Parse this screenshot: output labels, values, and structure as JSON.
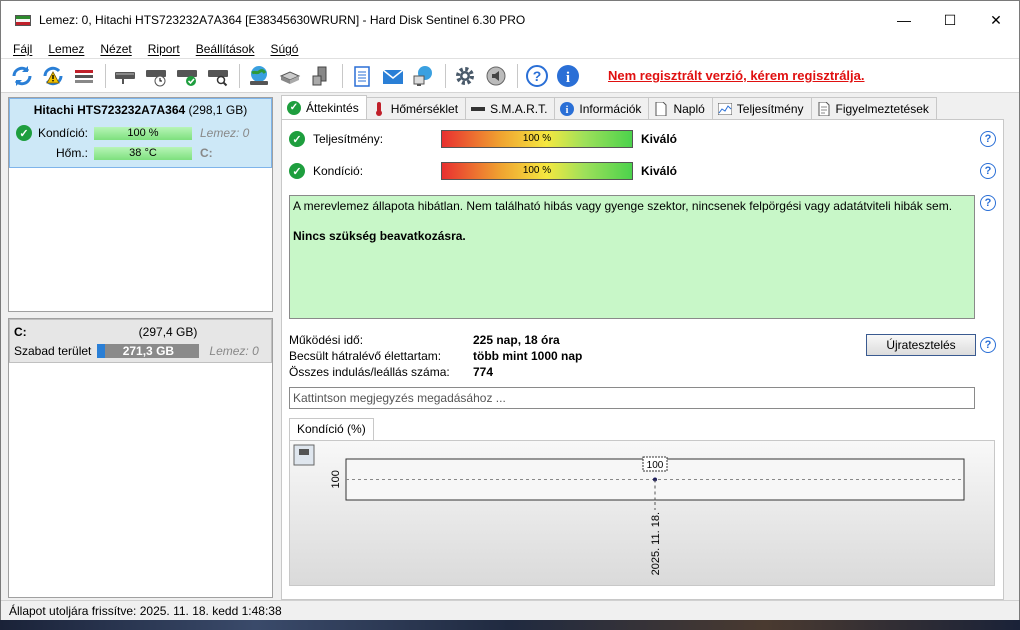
{
  "window": {
    "title": "Lemez: 0, Hitachi HTS723232A7A364 [E38345630WRURN]  -  Hard Disk Sentinel 6.30 PRO",
    "minimize": "—",
    "maximize": "☐",
    "close": "✕"
  },
  "menu": [
    "Fájl",
    "Lemez",
    "Nézet",
    "Riport",
    "Beállítások",
    "Súgó"
  ],
  "toolbar": {
    "icons": [
      "refresh-icon",
      "refresh-warning-icon",
      "disk-bar-icon",
      "disk-icon",
      "disk-clock-icon",
      "disk-check-icon",
      "disk-search-icon",
      "globe-icon",
      "drive-icon",
      "hdd-network-icon",
      "notepad-icon",
      "mail-icon",
      "network-monitor-icon",
      "gear-icon",
      "speaker-icon",
      "help-icon",
      "info-icon"
    ],
    "registration_warning": "Nem regisztrált verzió, kérem regisztrálja."
  },
  "disk": {
    "name": "Hitachi HTS723232A7A364",
    "size": "(298,1 GB)",
    "condition_label": "Kondíció:",
    "condition_value": "100 %",
    "condition_extra": "Lemez: 0",
    "temp_label": "Hőm.:",
    "temp_value": "38 °C",
    "temp_extra": "C:"
  },
  "partition": {
    "drive": "C:",
    "size": "(297,4 GB)",
    "free_label": "Szabad terület",
    "free_value": "271,3 GB",
    "free_extra": "Lemez: 0",
    "free_fraction": 0.09
  },
  "tabs": [
    {
      "label": "Áttekintés",
      "icon": "check-icon"
    },
    {
      "label": "Hőmérséklet",
      "icon": "thermometer-icon"
    },
    {
      "label": "S.M.A.R.T.",
      "icon": "smart-icon"
    },
    {
      "label": "Információk",
      "icon": "info-icon"
    },
    {
      "label": "Napló",
      "icon": "document-icon"
    },
    {
      "label": "Teljesítmény",
      "icon": "performance-chart-icon"
    },
    {
      "label": "Figyelmeztetések",
      "icon": "warning-doc-icon"
    }
  ],
  "overview": {
    "performance_label": "Teljesítmény:",
    "performance_value": "100 %",
    "performance_verdict": "Kiváló",
    "condition_label": "Kondíció:",
    "condition_value": "100 %",
    "condition_verdict": "Kiváló",
    "description": "A merevlemez állapota hibátlan. Nem található hibás vagy gyenge szektor, nincsenek felpörgési vagy adatátviteli hibák sem.",
    "recommendation": "Nincs szükség beavatkozásra.",
    "uptime_label": "Működési idő:",
    "uptime_value": "225 nap, 18 óra",
    "remaining_label": "Becsült hátralévő élettartam:",
    "remaining_value": "több mint 1000 nap",
    "startstop_label": "Összes indulás/leállás száma:",
    "startstop_value": "774",
    "retest_button": "Újratesztelés",
    "comment_placeholder": "Kattintson megjegyzés megadásához ..."
  },
  "chart_tab": "Kondíció  (%)",
  "chart_data": {
    "type": "line",
    "x": [
      "2025. 11. 18."
    ],
    "series": [
      {
        "values": [
          100
        ]
      }
    ],
    "ylabel": "",
    "y_tick": "100",
    "data_labels": [
      "100"
    ]
  },
  "statusbar": "Állapot utoljára frissítve: 2025. 11. 18. kedd 1:48:38"
}
